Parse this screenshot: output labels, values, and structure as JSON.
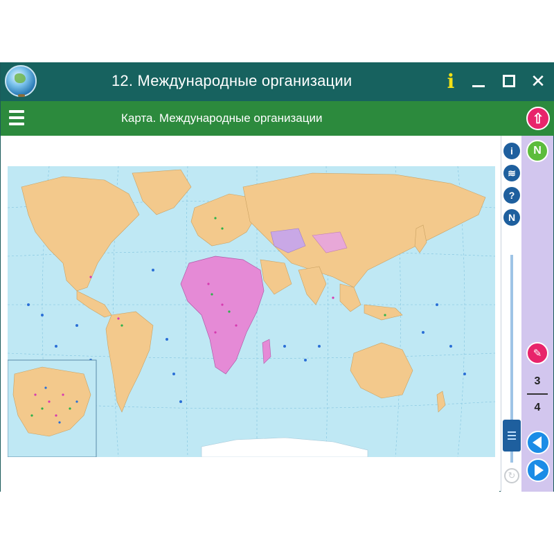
{
  "window": {
    "title": "12. Международные организации"
  },
  "titlebar": {
    "info_label": "i",
    "minimize_label": "",
    "maximize_label": "",
    "close_label": "✕"
  },
  "toolbar": {
    "subtitle": "Карта. Международные организации"
  },
  "tools": {
    "info_icon": "i",
    "layers_icon": "≋",
    "help_icon": "?",
    "n_icon": "N"
  },
  "rightpanel": {
    "n_button": "N",
    "page_current": "3",
    "page_total": "4"
  },
  "colors": {
    "titlebar": "#17625f",
    "toolbar": "#2c8a3d",
    "accent_pink": "#e8246b",
    "accent_green": "#5cbc3c",
    "nav_blue": "#1b8ce6",
    "panel_lavender": "#d2c6ee",
    "ocean": "#bfe8f4",
    "land": "#f3c98c",
    "africa": "#e58ad6"
  },
  "icons": [
    "globe-logo-icon",
    "info-icon",
    "minimize-icon",
    "maximize-icon",
    "close-icon",
    "hamburger-icon",
    "upload-arrow-icon",
    "layers-icon",
    "help-icon",
    "n-icon",
    "task-icon",
    "refresh-icon",
    "arrow-left-icon",
    "arrow-right-icon"
  ]
}
